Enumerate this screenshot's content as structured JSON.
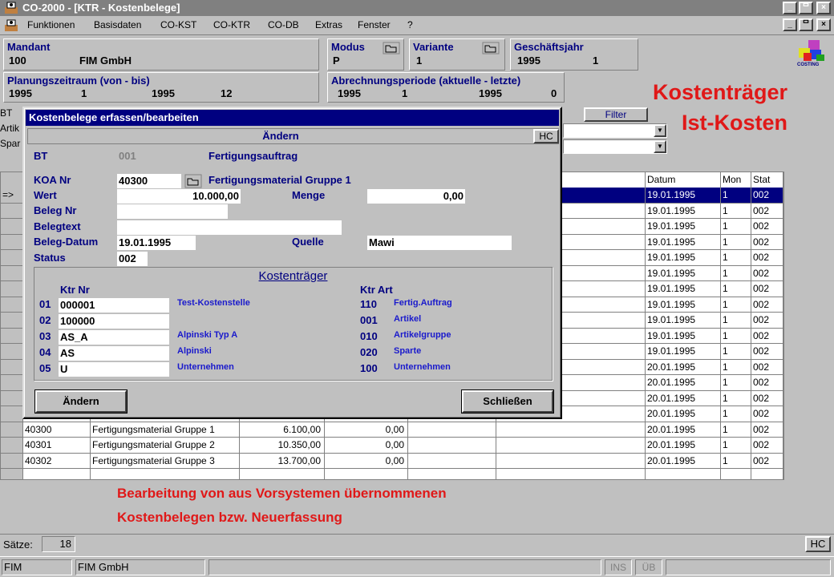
{
  "app": {
    "title": "CO-2000 - [KTR - Kostenbelege]",
    "menu": [
      "Funktionen",
      "Basisdaten",
      "CO-KST",
      "CO-KTR",
      "CO-DB",
      "Extras",
      "Fenster",
      "?"
    ],
    "window_buttons": [
      "_",
      "²",
      "×"
    ]
  },
  "header": {
    "mandant_label": "Mandant",
    "mandant_nr": "100",
    "mandant_name": "FIM GmbH",
    "modus_label": "Modus",
    "modus_value": "P",
    "variante_label": "Variante",
    "variante_value": "1",
    "gj_label": "Geschäftsjahr",
    "gj_year": "1995",
    "gj_period": "1",
    "pz_label": "Planungszeitraum  (von - bis)",
    "pz_from_year": "1995",
    "pz_from_period": "1",
    "pz_to_year": "1995",
    "pz_to_period": "12",
    "ap_label": "Abrechnungsperiode  (aktuelle - letzte)",
    "ap_cur_year": "1995",
    "ap_cur_period": "1",
    "ap_last_year": "1995",
    "ap_last_period": "0",
    "logo_text": "COSTING"
  },
  "overlay": {
    "title_line1": "Kostenträger",
    "title_line2": "Ist-Kosten",
    "caption_line1": "Bearbeitung von aus Vorsystemen übernommenen",
    "caption_line2": "Kostenbelegen bzw. Neuerfassung"
  },
  "filter": {
    "labels": [
      "BT",
      "Artik",
      "Spar"
    ],
    "filter_button": "Filter"
  },
  "grid": {
    "columns": {
      "datum": "Datum",
      "mon": "Mon",
      "stat": "Stat"
    },
    "row_marker": "=>",
    "right_rows": [
      [
        "19.01.1995",
        "1",
        "002"
      ],
      [
        "19.01.1995",
        "1",
        "002"
      ],
      [
        "19.01.1995",
        "1",
        "002"
      ],
      [
        "19.01.1995",
        "1",
        "002"
      ],
      [
        "19.01.1995",
        "1",
        "002"
      ],
      [
        "19.01.1995",
        "1",
        "002"
      ],
      [
        "19.01.1995",
        "1",
        "002"
      ],
      [
        "19.01.1995",
        "1",
        "002"
      ],
      [
        "19.01.1995",
        "1",
        "002"
      ],
      [
        "19.01.1995",
        "1",
        "002"
      ],
      [
        "19.01.1995",
        "1",
        "002"
      ],
      [
        "20.01.1995",
        "1",
        "002"
      ],
      [
        "20.01.1995",
        "1",
        "002"
      ],
      [
        "20.01.1995",
        "1",
        "002"
      ],
      [
        "20.01.1995",
        "1",
        "002"
      ],
      [
        "20.01.1995",
        "1",
        "002"
      ],
      [
        "20.01.1995",
        "1",
        "002"
      ],
      [
        "20.01.1995",
        "1",
        "002"
      ]
    ],
    "full_rows": [
      [
        "40300",
        "Fertigungsmaterial Gruppe 1",
        "6.100,00",
        "0,00"
      ],
      [
        "40301",
        "Fertigungsmaterial Gruppe 2",
        "10.350,00",
        "0,00"
      ],
      [
        "40302",
        "Fertigungsmaterial Gruppe 3",
        "13.700,00",
        "0,00"
      ]
    ]
  },
  "dialog": {
    "title": "Kostenbelege erfassen/bearbeiten",
    "mode": "Ändern",
    "hc": "HC",
    "bt_label": "BT",
    "bt_value": "001",
    "bt_text": "Fertigungsauftrag",
    "koa_label": "KOA Nr",
    "koa_value": "40300",
    "koa_text": "Fertigungsmaterial Gruppe 1",
    "wert_label": "Wert",
    "wert_value": "10.000,00",
    "menge_label": "Menge",
    "menge_value": "0,00",
    "belegnr_label": "Beleg Nr",
    "belegnr_value": "",
    "belegtext_label": "Belegtext",
    "belegtext_value": "",
    "belegdatum_label": "Beleg-Datum",
    "belegdatum_value": "19.01.1995",
    "quelle_label": "Quelle",
    "quelle_value": "Mawi",
    "status_label": "Status",
    "status_value": "002",
    "ktr_group_title": "Kostenträger",
    "ktr_nr_header": "Ktr Nr",
    "ktr_art_header": "Ktr Art",
    "ktr_rows": [
      {
        "idx": "01",
        "nr": "000001",
        "name": "Test-Kostenstelle",
        "art": "110",
        "art_name": "Fertig.Auftrag"
      },
      {
        "idx": "02",
        "nr": "100000",
        "name": "",
        "art": "001",
        "art_name": "Artikel"
      },
      {
        "idx": "03",
        "nr": "AS_A",
        "name": "Alpinski Typ A",
        "art": "010",
        "art_name": "Artikelgruppe"
      },
      {
        "idx": "04",
        "nr": "AS",
        "name": "Alpinski",
        "art": "020",
        "art_name": "Sparte"
      },
      {
        "idx": "05",
        "nr": "U",
        "name": "Unternehmen",
        "art": "100",
        "art_name": "Unternehmen"
      }
    ],
    "btn_change": "Ändern",
    "btn_close": "Schließen"
  },
  "footer": {
    "saetze_label": "Sätze:",
    "saetze_value": "18",
    "hc": "HC",
    "status_left": "FIM",
    "status_company": "FIM GmbH",
    "ins": "INS",
    "ueb": "ÜB"
  }
}
